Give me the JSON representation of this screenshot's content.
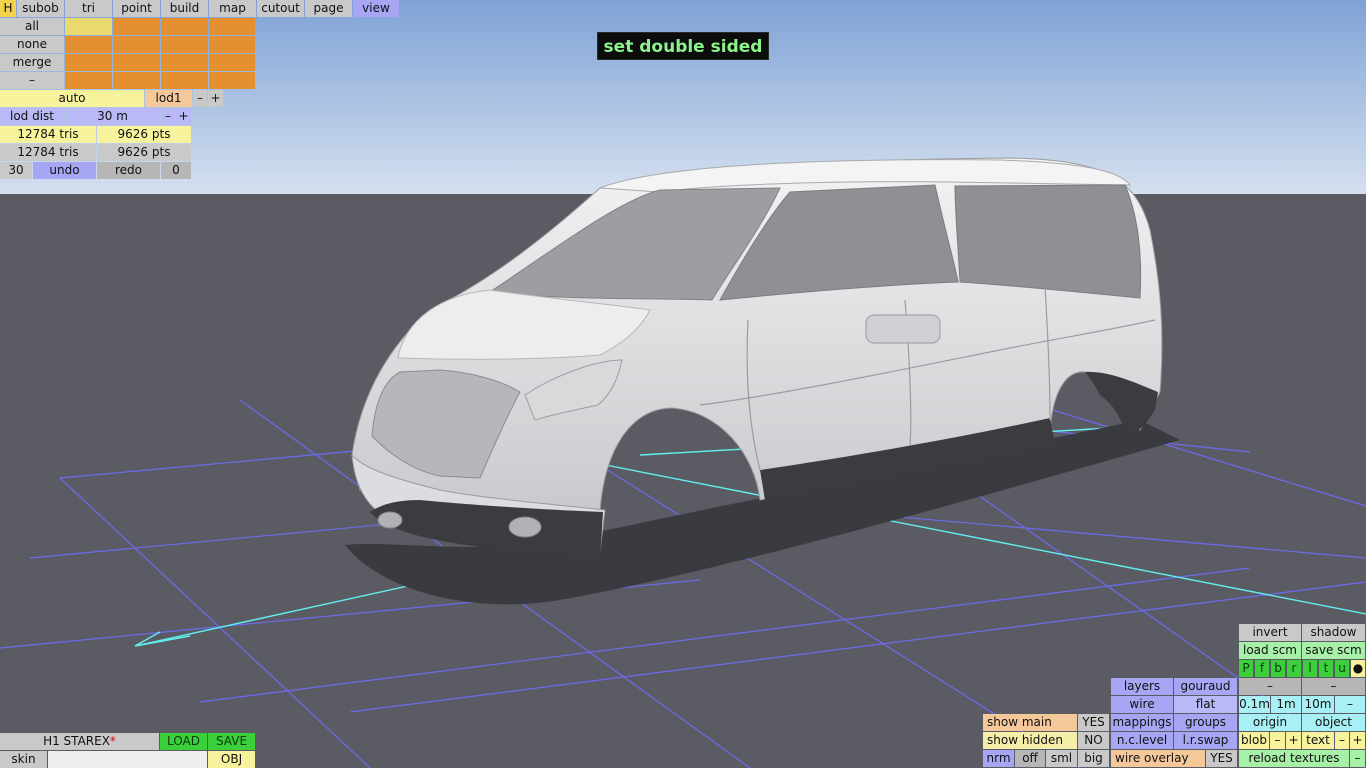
{
  "top_menu": {
    "h": "H",
    "subob": "subob",
    "tri": "tri",
    "point": "point",
    "build": "build",
    "map": "map",
    "cutout": "cutout",
    "page": "page",
    "view": "view"
  },
  "select_panel": {
    "all": "all",
    "none": "none",
    "merge": "merge",
    "dash": "–"
  },
  "lod": {
    "auto": "auto",
    "lod1": "lod1",
    "minus": "–",
    "plus": "+",
    "lod_dist_label": "lod dist",
    "lod_dist_value": "30 m"
  },
  "stats": {
    "row1_tris": "12784 tris",
    "row1_pts": "9626 pts",
    "row2_tris": "12784 tris",
    "row2_pts": "9626 pts"
  },
  "history": {
    "count": "30",
    "undo": "undo",
    "redo": "redo",
    "redo_count": "0"
  },
  "message": "set double sided",
  "file": {
    "name": "H1 STAREX",
    "modified_mark": "*",
    "load": "LOAD",
    "save": "SAVE",
    "skin": "skin",
    "obj": "OBJ"
  },
  "view_panel": {
    "invert": "invert",
    "shadow": "shadow",
    "load_scm": "load scm",
    "save_scm": "save scm",
    "letters": [
      "P",
      "f",
      "b",
      "r",
      "l",
      "t",
      "u"
    ],
    "dot": "●",
    "layers": "layers",
    "gouraud": "gouraud",
    "dash1": "–",
    "dash2": "–",
    "wire": "wire",
    "flat": "flat",
    "g01": "0.1m",
    "g1": "1m",
    "g10": "10m",
    "gminus": "–",
    "show_main": "show main",
    "show_main_val": "YES",
    "mappings": "mappings",
    "groups": "groups",
    "origin": "origin",
    "object": "object",
    "show_hidden": "show hidden",
    "show_hidden_val": "NO",
    "nc_level": "n.c.level",
    "lr_swap": "l.r.swap",
    "blob": "blob",
    "blob_minus": "–",
    "blob_plus": "+",
    "text": "text",
    "text_minus": "–",
    "text_plus": "+",
    "nrm": "nrm",
    "off": "off",
    "sml": "sml",
    "big": "big",
    "wire_overlay": "wire overlay",
    "wire_overlay_val": "YES",
    "reload_textures": "reload textures",
    "reload_minus": "–"
  },
  "colors": {
    "sky_top": "#7fa2d6",
    "sky_bottom": "#d4e0ef",
    "floor": "#5b5c63",
    "grid": "#6b6bf0",
    "axis": "#62eef0",
    "body": "#e3e4e6",
    "skirt": "#3a3c40"
  }
}
